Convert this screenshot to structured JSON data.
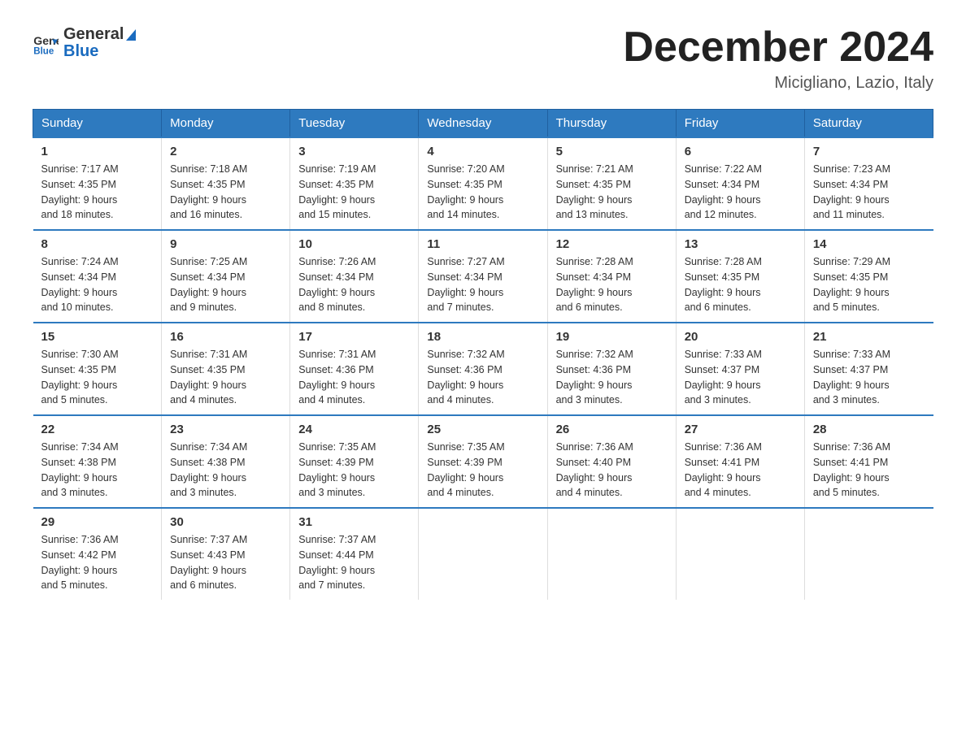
{
  "logo": {
    "text_general": "General",
    "text_blue": "Blue"
  },
  "header": {
    "month": "December 2024",
    "location": "Micigliano, Lazio, Italy"
  },
  "days_of_week": [
    "Sunday",
    "Monday",
    "Tuesday",
    "Wednesday",
    "Thursday",
    "Friday",
    "Saturday"
  ],
  "weeks": [
    [
      {
        "day": "1",
        "sunrise": "7:17 AM",
        "sunset": "4:35 PM",
        "daylight": "9 hours and 18 minutes."
      },
      {
        "day": "2",
        "sunrise": "7:18 AM",
        "sunset": "4:35 PM",
        "daylight": "9 hours and 16 minutes."
      },
      {
        "day": "3",
        "sunrise": "7:19 AM",
        "sunset": "4:35 PM",
        "daylight": "9 hours and 15 minutes."
      },
      {
        "day": "4",
        "sunrise": "7:20 AM",
        "sunset": "4:35 PM",
        "daylight": "9 hours and 14 minutes."
      },
      {
        "day": "5",
        "sunrise": "7:21 AM",
        "sunset": "4:35 PM",
        "daylight": "9 hours and 13 minutes."
      },
      {
        "day": "6",
        "sunrise": "7:22 AM",
        "sunset": "4:34 PM",
        "daylight": "9 hours and 12 minutes."
      },
      {
        "day": "7",
        "sunrise": "7:23 AM",
        "sunset": "4:34 PM",
        "daylight": "9 hours and 11 minutes."
      }
    ],
    [
      {
        "day": "8",
        "sunrise": "7:24 AM",
        "sunset": "4:34 PM",
        "daylight": "9 hours and 10 minutes."
      },
      {
        "day": "9",
        "sunrise": "7:25 AM",
        "sunset": "4:34 PM",
        "daylight": "9 hours and 9 minutes."
      },
      {
        "day": "10",
        "sunrise": "7:26 AM",
        "sunset": "4:34 PM",
        "daylight": "9 hours and 8 minutes."
      },
      {
        "day": "11",
        "sunrise": "7:27 AM",
        "sunset": "4:34 PM",
        "daylight": "9 hours and 7 minutes."
      },
      {
        "day": "12",
        "sunrise": "7:28 AM",
        "sunset": "4:34 PM",
        "daylight": "9 hours and 6 minutes."
      },
      {
        "day": "13",
        "sunrise": "7:28 AM",
        "sunset": "4:35 PM",
        "daylight": "9 hours and 6 minutes."
      },
      {
        "day": "14",
        "sunrise": "7:29 AM",
        "sunset": "4:35 PM",
        "daylight": "9 hours and 5 minutes."
      }
    ],
    [
      {
        "day": "15",
        "sunrise": "7:30 AM",
        "sunset": "4:35 PM",
        "daylight": "9 hours and 5 minutes."
      },
      {
        "day": "16",
        "sunrise": "7:31 AM",
        "sunset": "4:35 PM",
        "daylight": "9 hours and 4 minutes."
      },
      {
        "day": "17",
        "sunrise": "7:31 AM",
        "sunset": "4:36 PM",
        "daylight": "9 hours and 4 minutes."
      },
      {
        "day": "18",
        "sunrise": "7:32 AM",
        "sunset": "4:36 PM",
        "daylight": "9 hours and 4 minutes."
      },
      {
        "day": "19",
        "sunrise": "7:32 AM",
        "sunset": "4:36 PM",
        "daylight": "9 hours and 3 minutes."
      },
      {
        "day": "20",
        "sunrise": "7:33 AM",
        "sunset": "4:37 PM",
        "daylight": "9 hours and 3 minutes."
      },
      {
        "day": "21",
        "sunrise": "7:33 AM",
        "sunset": "4:37 PM",
        "daylight": "9 hours and 3 minutes."
      }
    ],
    [
      {
        "day": "22",
        "sunrise": "7:34 AM",
        "sunset": "4:38 PM",
        "daylight": "9 hours and 3 minutes."
      },
      {
        "day": "23",
        "sunrise": "7:34 AM",
        "sunset": "4:38 PM",
        "daylight": "9 hours and 3 minutes."
      },
      {
        "day": "24",
        "sunrise": "7:35 AM",
        "sunset": "4:39 PM",
        "daylight": "9 hours and 3 minutes."
      },
      {
        "day": "25",
        "sunrise": "7:35 AM",
        "sunset": "4:39 PM",
        "daylight": "9 hours and 4 minutes."
      },
      {
        "day": "26",
        "sunrise": "7:36 AM",
        "sunset": "4:40 PM",
        "daylight": "9 hours and 4 minutes."
      },
      {
        "day": "27",
        "sunrise": "7:36 AM",
        "sunset": "4:41 PM",
        "daylight": "9 hours and 4 minutes."
      },
      {
        "day": "28",
        "sunrise": "7:36 AM",
        "sunset": "4:41 PM",
        "daylight": "9 hours and 5 minutes."
      }
    ],
    [
      {
        "day": "29",
        "sunrise": "7:36 AM",
        "sunset": "4:42 PM",
        "daylight": "9 hours and 5 minutes."
      },
      {
        "day": "30",
        "sunrise": "7:37 AM",
        "sunset": "4:43 PM",
        "daylight": "9 hours and 6 minutes."
      },
      {
        "day": "31",
        "sunrise": "7:37 AM",
        "sunset": "4:44 PM",
        "daylight": "9 hours and 7 minutes."
      },
      null,
      null,
      null,
      null
    ]
  ],
  "labels": {
    "sunrise": "Sunrise:",
    "sunset": "Sunset:",
    "daylight": "Daylight:"
  }
}
